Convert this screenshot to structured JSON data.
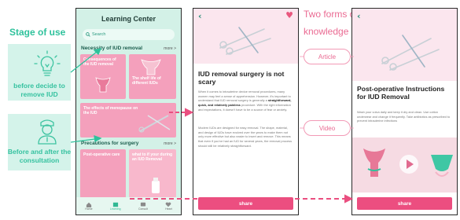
{
  "stage": {
    "title": "Stage of use",
    "before_remove": "before  decide to remove IUD",
    "before_after": "Before and after the consultation"
  },
  "learning_center": {
    "title": "Learning Center",
    "search_placeholder": "Search",
    "section1": {
      "title": "Necessity of IUD removal",
      "more": "more >"
    },
    "section2": {
      "title": "Precautions for surgery",
      "more": "more >"
    },
    "cards": {
      "c1": "Consequences of the IUD removal",
      "c2": "The shelf life of different IUDs",
      "c3": "The effects of menopause on the IUD",
      "c4": "Post-operative care",
      "c5": "what to if your during an IUD Removal"
    },
    "tabs": [
      "Home",
      "Learning",
      "Consult",
      "Heart"
    ]
  },
  "middle": {
    "forms_line1": "Two forms of",
    "forms_line2": "knowledge",
    "article": "Article",
    "video": "Video"
  },
  "article": {
    "title": "IUD removal surgery is not scary",
    "para1_a": "When it comes to intrauterine device removal procedures, many women may feel a sense of apprehension. However, it's important to understand that IUD removal surgery is generally a ",
    "para1_b": "straightforward, quick, and relatively painless",
    "para1_c": " procedure. With the right information and expectations, it doesn't have to be a source of fear or anxiety.",
    "para2": "Modern IUDs are designed for easy removal. The shape, material, and design of IUDs have evolved over the years to make them not only more effective but also easier to insert and remove. This means that even if you've had an IUD for several years, the removal process should still be relatively straightforward.",
    "share": "share"
  },
  "video_page": {
    "title": "Post-operative Instructions for IUD Removal",
    "body": "Wash your vulva daily and keep it dry and clean. Use cotton underwear and change it frequently. Take antibiotics as prescribed to prevent intrauterine infections",
    "share": "share"
  },
  "colors": {
    "green": "#2fc29c",
    "pink": "#ec4e80",
    "light_green": "#d4f3ea",
    "light_pink": "#fbe6ee"
  }
}
